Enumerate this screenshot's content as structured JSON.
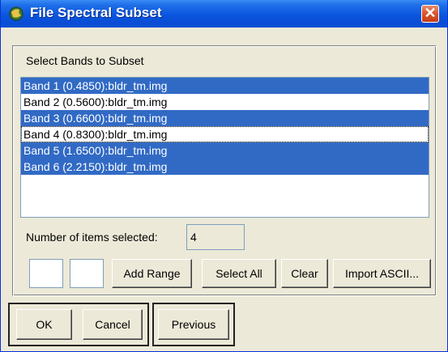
{
  "window": {
    "title": "File Spectral Subset",
    "close_label": "✕"
  },
  "group": {
    "label": "Select Bands to Subset"
  },
  "bands": [
    {
      "label": "Band 1 (0.4850):bldr_tm.img",
      "selected": true
    },
    {
      "label": "Band 2 (0.5600):bldr_tm.img",
      "selected": false
    },
    {
      "label": "Band 3 (0.6600):bldr_tm.img",
      "selected": true
    },
    {
      "label": "Band 4 (0.8300):bldr_tm.img",
      "selected": false,
      "focused": true
    },
    {
      "label": "Band 5 (1.6500):bldr_tm.img",
      "selected": true
    },
    {
      "label": "Band 6 (2.2150):bldr_tm.img",
      "selected": true
    }
  ],
  "selection": {
    "count_label": "Number of items selected:",
    "count_value": "4"
  },
  "range": {
    "start_value": "",
    "end_value": ""
  },
  "buttons": {
    "add_range": "Add Range",
    "select_all": "Select All",
    "clear": "Clear",
    "import_ascii": "Import ASCII...",
    "ok": "OK",
    "cancel": "Cancel",
    "previous": "Previous"
  },
  "colors": {
    "selection": "#316ac5",
    "titlebar": "#0b55de",
    "close": "#d9532c"
  },
  "icons": {
    "title": "envi-globe-icon",
    "close": "close-icon"
  }
}
